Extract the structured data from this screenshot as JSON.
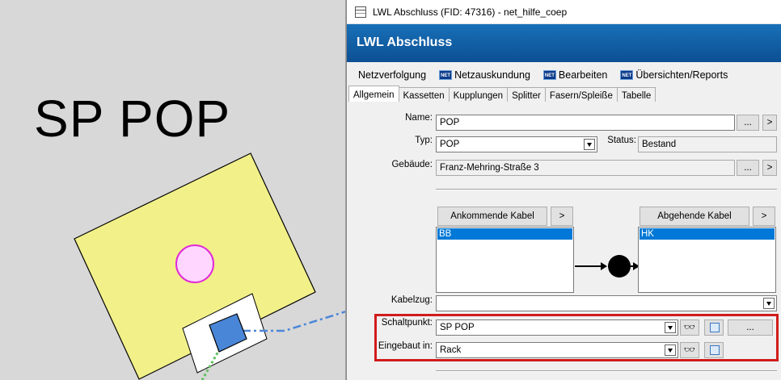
{
  "map": {
    "label": "SP POP"
  },
  "window": {
    "title": "LWL Abschluss (FID: 47316) - net_hilfe_coep"
  },
  "header": {
    "title": "LWL Abschluss"
  },
  "menu": {
    "items": [
      {
        "label": "Netzverfolgung"
      },
      {
        "label": "Netzauskundung"
      },
      {
        "label": "Bearbeiten"
      },
      {
        "label": "Übersichten/Reports"
      }
    ],
    "net_icon_text": "NET"
  },
  "tabs": [
    {
      "label": "Allgemein",
      "active": true
    },
    {
      "label": "Kassetten"
    },
    {
      "label": "Kupplungen"
    },
    {
      "label": "Splitter"
    },
    {
      "label": "Fasern/Spleiße"
    },
    {
      "label": "Tabelle"
    }
  ],
  "form": {
    "name_label": "Name:",
    "name_value": "POP",
    "typ_label": "Typ:",
    "typ_value": "POP",
    "status_label": "Status:",
    "status_value": "Bestand",
    "gebaeude_label": "Gebäude:",
    "gebaeude_value": "Franz-Mehring-Straße 3",
    "ellipsis": "...",
    "arrow": ">",
    "ankommende_label": "Ankommende Kabel",
    "ankommende_items": [
      "BB"
    ],
    "abgehende_label": "Abgehende Kabel",
    "abgehende_items": [
      "HK"
    ],
    "kabelzug_label": "Kabelzug:",
    "kabelzug_value": "",
    "schaltpunkt_label": "Schaltpunkt:",
    "schaltpunkt_value": "SP POP",
    "eingebaut_label": "Eingebaut in:",
    "eingebaut_value": "Rack"
  },
  "colors": {
    "header_blue": "#0c4f93",
    "highlight_red": "#d01c1c",
    "selection_blue": "#0078d7",
    "building_yellow": "#f2f089",
    "point_pink": "#ff9bff",
    "sp_blue": "#4a86d8"
  }
}
